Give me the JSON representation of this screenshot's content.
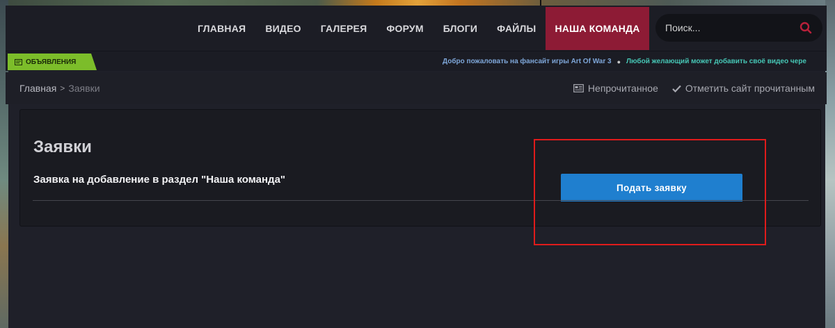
{
  "nav": {
    "items": [
      {
        "label": "ГЛАВНАЯ"
      },
      {
        "label": "ВИДЕО"
      },
      {
        "label": "ГАЛЕРЕЯ"
      },
      {
        "label": "ФОРУМ"
      },
      {
        "label": "БЛОГИ"
      },
      {
        "label": "ФАЙЛЫ"
      },
      {
        "label": "НАША КОМАНДА",
        "active": true
      }
    ],
    "active_color": "#8d1b35"
  },
  "search": {
    "placeholder": "Поиск...",
    "icon": "search-icon",
    "icon_color": "#b8203a"
  },
  "announcements": {
    "badge_label": "ОБЪЯВЛЕНИЯ",
    "badge_color": "#7cbd2a",
    "ticker": [
      "Добро пожаловать на фансайт игры Art Of War 3",
      "Любой желающий может добавить своё видео чере"
    ]
  },
  "breadcrumb": {
    "home": "Главная",
    "current": "Заявки"
  },
  "actions": {
    "unread": "Непрочитанное",
    "mark_read": "Отметить сайт прочитанным"
  },
  "panel": {
    "title": "Заявки",
    "subtitle": "Заявка на добавление в раздел \"Наша команда\"",
    "button_label": "Подать заявку",
    "button_color": "#1f7fcf"
  },
  "highlight_color": "#e01b1b"
}
